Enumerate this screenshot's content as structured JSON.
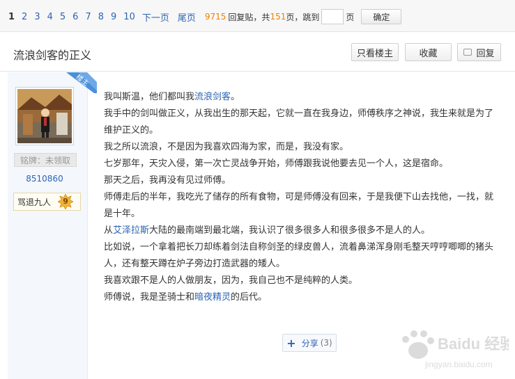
{
  "pager": {
    "current": "1",
    "pages": [
      "2",
      "3",
      "4",
      "5",
      "6",
      "7",
      "8",
      "9",
      "10"
    ],
    "next": "下一页",
    "last": "尾页",
    "reply_count": "9715",
    "reply_label": "回复贴，共",
    "total_pages": "151",
    "pages_label": "页，跳到",
    "page_unit": "页",
    "jump_value": "",
    "confirm": "确定"
  },
  "thread": {
    "title": "流浪剑客的正义",
    "only_op": "只看楼主",
    "favorite": "收藏",
    "reply": "回复"
  },
  "author": {
    "op_tag": "楼主",
    "badge": "铭牌：未领取",
    "id": "8510860",
    "level_name": "骂退九人",
    "level": "9"
  },
  "post": {
    "lines": [
      {
        "a": "我叫斯温，他们都叫我",
        "link": "流浪剑客",
        "b": "。"
      },
      {
        "a": "我手中的剑叫做正义，从我出生的那天起，它就一直在我身边，师傅秩序之神说，我生来就是为了维护正义的。"
      },
      {
        "a": "我之所以流浪，不是因为我喜欢四海为家，而是，我没有家。"
      },
      {
        "a": "七岁那年，天灾入侵，第一次亡灵战争开始，师傅跟我说他要去见一个人，这是宿命。"
      },
      {
        "a": "那天之后，我再没有见过师傅。"
      },
      {
        "a": "师傅走后的半年，我吃光了储存的所有食物，可是师傅没有回来，于是我便下山去找他，一找，就是十年。"
      },
      {
        "a": "从",
        "link": "艾泽拉斯",
        "b": "大陆的最南端到最北端，我认识了很多很多人和很多很多不是人的人。"
      },
      {
        "a": "比如说，一个拿着把长刀却练着剑法自称剑圣的绿皮兽人，流着鼻涕浑身刚毛整天哼哼唧唧的猪头人，还有整天蹲在炉子旁边打造武器的矮人。"
      },
      {
        "a": "我喜欢跟不是人的人做朋友，因为，我自己也不是纯粹的人类。"
      },
      {
        "a": "师傅说，我是圣骑士和",
        "link": "暗夜精灵",
        "b": "的后代。"
      }
    ],
    "share_label": "分享",
    "share_count": "(3)"
  },
  "watermark": {
    "brand": "Baidu 经验",
    "url": "jingyan.baidu.com"
  },
  "colors": {
    "link": "#2d64b3",
    "count": "#f08000",
    "op_tag": "#4a8fdb"
  }
}
